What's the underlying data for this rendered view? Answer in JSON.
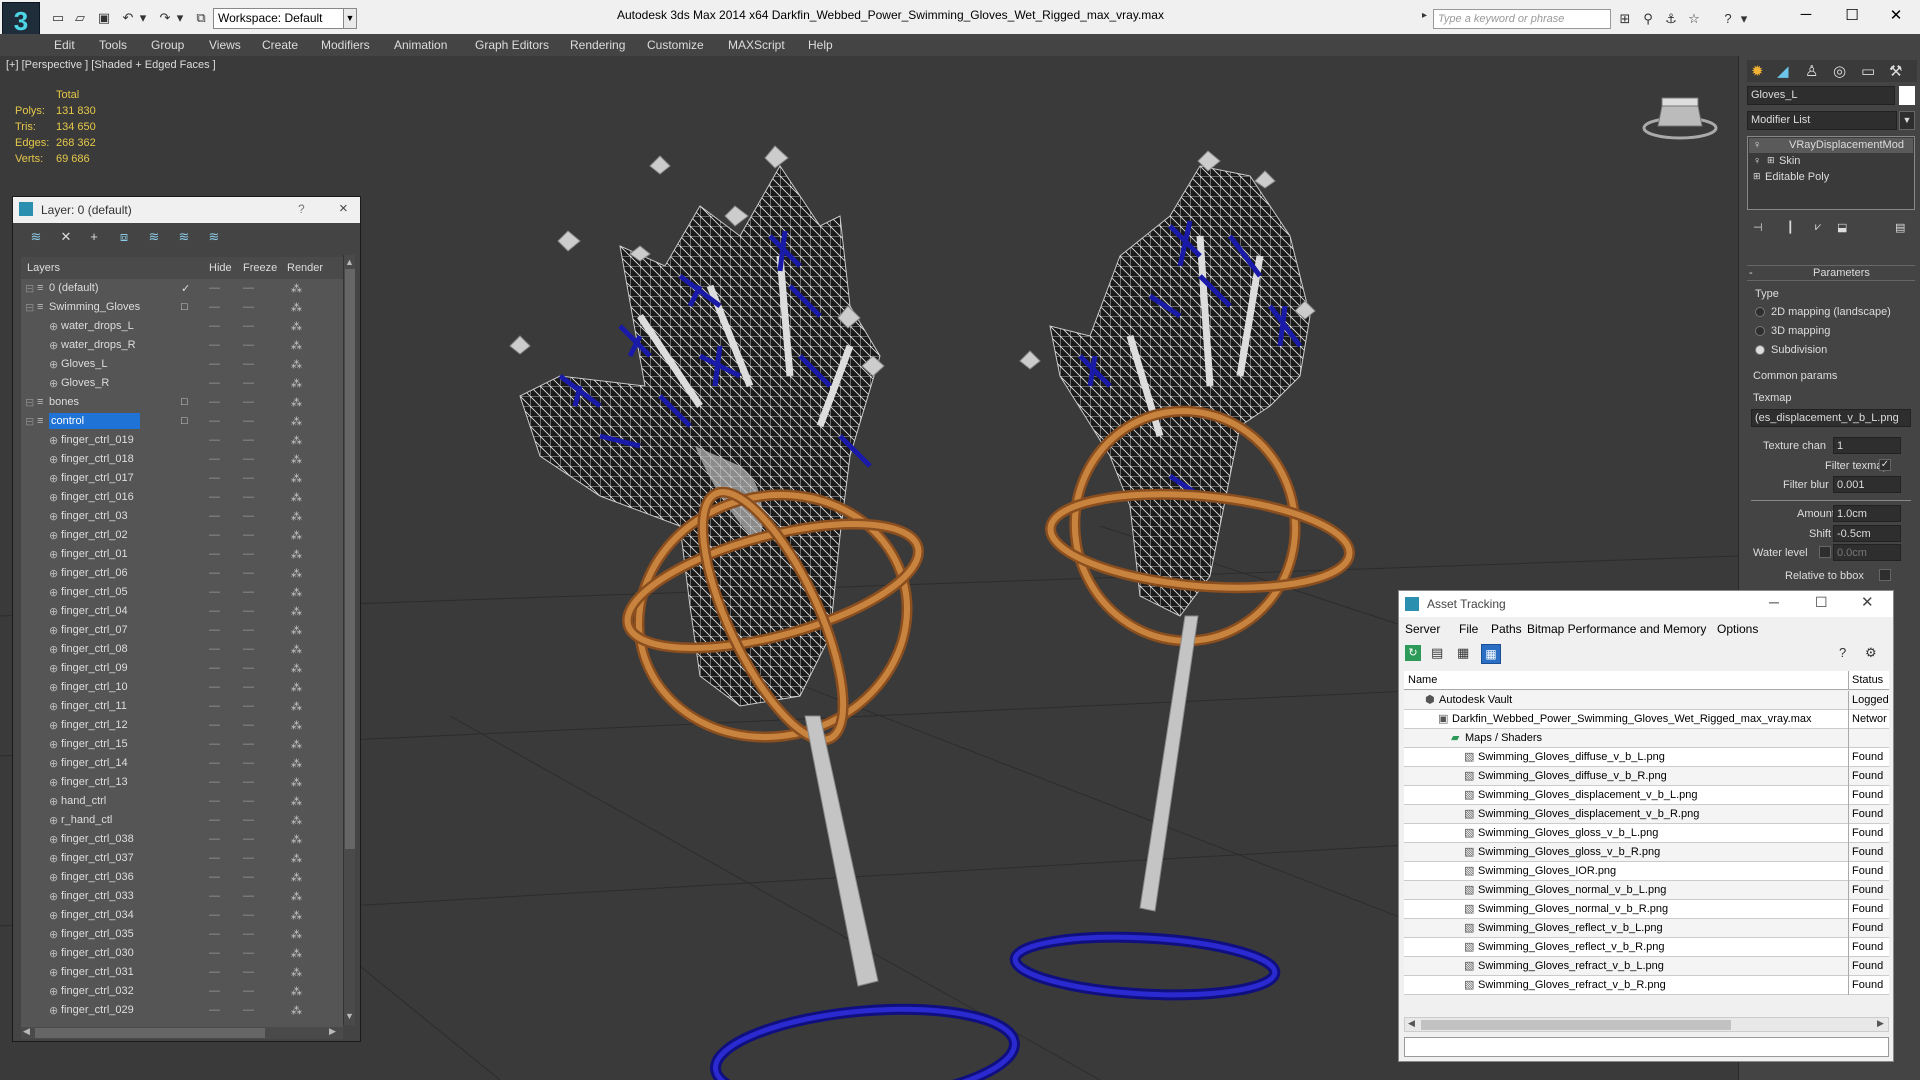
{
  "app": {
    "logo_glyph": "3",
    "title": "Autodesk 3ds Max  2014 x64      Darkfin_Webbed_Power_Swimming_Gloves_Wet_Rigged_max_vray.max",
    "workspace": "Workspace: Default",
    "search_placeholder": "Type a keyword or phrase"
  },
  "menu": [
    "Edit",
    "Tools",
    "Group",
    "Views",
    "Create",
    "Modifiers",
    "Animation",
    "Graph Editors",
    "Rendering",
    "Customize",
    "MAXScript",
    "Help"
  ],
  "viewport": {
    "label": "[+] [Perspective ] [Shaded + Edged Faces ]",
    "stats": {
      "header": "Total",
      "polys_label": "Polys:",
      "polys": "131 830",
      "tris_label": "Tris:",
      "tris": "134 650",
      "edges_label": "Edges:",
      "edges": "268 362",
      "verts_label": "Verts:",
      "verts": "69 686"
    }
  },
  "layer_panel": {
    "title": "Layer: 0 (default)",
    "help": "?",
    "close": "×",
    "columns": {
      "layers": "Layers",
      "hide": "Hide",
      "freeze": "Freeze",
      "render": "Render"
    },
    "rows": [
      {
        "name": "0 (default)",
        "level": 1,
        "check": "✓"
      },
      {
        "name": "Swimming_Gloves",
        "level": 1,
        "check": "□"
      },
      {
        "name": "water_drops_L",
        "level": 2
      },
      {
        "name": "water_drops_R",
        "level": 2
      },
      {
        "name": "Gloves_L",
        "level": 2
      },
      {
        "name": "Gloves_R",
        "level": 2
      },
      {
        "name": "bones",
        "level": 1,
        "check": "□"
      },
      {
        "name": "control",
        "level": 1,
        "check": "□",
        "selected": true
      },
      {
        "name": "finger_ctrl_019",
        "level": 2
      },
      {
        "name": "finger_ctrl_018",
        "level": 2
      },
      {
        "name": "finger_ctrl_017",
        "level": 2
      },
      {
        "name": "finger_ctrl_016",
        "level": 2
      },
      {
        "name": "finger_ctrl_03",
        "level": 2
      },
      {
        "name": "finger_ctrl_02",
        "level": 2
      },
      {
        "name": "finger_ctrl_01",
        "level": 2
      },
      {
        "name": "finger_ctrl_06",
        "level": 2
      },
      {
        "name": "finger_ctrl_05",
        "level": 2
      },
      {
        "name": "finger_ctrl_04",
        "level": 2
      },
      {
        "name": "finger_ctrl_07",
        "level": 2
      },
      {
        "name": "finger_ctrl_08",
        "level": 2
      },
      {
        "name": "finger_ctrl_09",
        "level": 2
      },
      {
        "name": "finger_ctrl_10",
        "level": 2
      },
      {
        "name": "finger_ctrl_11",
        "level": 2
      },
      {
        "name": "finger_ctrl_12",
        "level": 2
      },
      {
        "name": "finger_ctrl_15",
        "level": 2
      },
      {
        "name": "finger_ctrl_14",
        "level": 2
      },
      {
        "name": "finger_ctrl_13",
        "level": 2
      },
      {
        "name": "hand_ctrl",
        "level": 2
      },
      {
        "name": "r_hand_ctl",
        "level": 2
      },
      {
        "name": "finger_ctrl_038",
        "level": 2
      },
      {
        "name": "finger_ctrl_037",
        "level": 2
      },
      {
        "name": "finger_ctrl_036",
        "level": 2
      },
      {
        "name": "finger_ctrl_033",
        "level": 2
      },
      {
        "name": "finger_ctrl_034",
        "level": 2
      },
      {
        "name": "finger_ctrl_035",
        "level": 2
      },
      {
        "name": "finger_ctrl_030",
        "level": 2
      },
      {
        "name": "finger_ctrl_031",
        "level": 2
      },
      {
        "name": "finger_ctrl_032",
        "level": 2
      },
      {
        "name": "finger_ctrl_029",
        "level": 2
      }
    ]
  },
  "command_panel": {
    "object_name": "Gloves_L",
    "modifier_list": "Modifier List",
    "stack": [
      "VRayDisplacementMod",
      "Skin",
      "Editable Poly"
    ],
    "rollout_title": "Parameters",
    "type_label": "Type",
    "type_options": [
      "2D mapping (landscape)",
      "3D mapping",
      "Subdivision"
    ],
    "type_selected": 2,
    "common_params": "Common params",
    "texmap_label": "Texmap",
    "texmap_value": "es_displacement_v_b_L.png)",
    "texture_chan_label": "Texture chan",
    "texture_chan": "1",
    "filter_texmap_label": "Filter texmap",
    "filter_blur_label": "Filter blur",
    "filter_blur": "0.001",
    "amount_label": "Amount",
    "amount": "1.0cm",
    "shift_label": "Shift",
    "shift": "-0.5cm",
    "water_level_label": "Water level",
    "water_level": "0.0cm",
    "relative_label": "Relative to bbox"
  },
  "asset_tracking": {
    "title": "Asset Tracking",
    "menu": [
      "Server",
      "File",
      "Paths",
      "Bitmap Performance and Memory",
      "Options"
    ],
    "col_name": "Name",
    "col_status": "Status",
    "rows": [
      {
        "name": "Autodesk Vault",
        "indent": 1,
        "status": "Logged"
      },
      {
        "name": "Darkfin_Webbed_Power_Swimming_Gloves_Wet_Rigged_max_vray.max",
        "indent": 2,
        "status": "Networ"
      },
      {
        "name": "Maps / Shaders",
        "indent": 3,
        "status": ""
      },
      {
        "name": "Swimming_Gloves_diffuse_v_b_L.png",
        "indent": 4,
        "status": "Found"
      },
      {
        "name": "Swimming_Gloves_diffuse_v_b_R.png",
        "indent": 4,
        "status": "Found"
      },
      {
        "name": "Swimming_Gloves_displacement_v_b_L.png",
        "indent": 4,
        "status": "Found"
      },
      {
        "name": "Swimming_Gloves_displacement_v_b_R.png",
        "indent": 4,
        "status": "Found"
      },
      {
        "name": "Swimming_Gloves_gloss_v_b_L.png",
        "indent": 4,
        "status": "Found"
      },
      {
        "name": "Swimming_Gloves_gloss_v_b_R.png",
        "indent": 4,
        "status": "Found"
      },
      {
        "name": "Swimming_Gloves_IOR.png",
        "indent": 4,
        "status": "Found"
      },
      {
        "name": "Swimming_Gloves_normal_v_b_L.png",
        "indent": 4,
        "status": "Found"
      },
      {
        "name": "Swimming_Gloves_normal_v_b_R.png",
        "indent": 4,
        "status": "Found"
      },
      {
        "name": "Swimming_Gloves_reflect_v_b_L.png",
        "indent": 4,
        "status": "Found"
      },
      {
        "name": "Swimming_Gloves_reflect_v_b_R.png",
        "indent": 4,
        "status": "Found"
      },
      {
        "name": "Swimming_Gloves_refract_v_b_L.png",
        "indent": 4,
        "status": "Found"
      },
      {
        "name": "Swimming_Gloves_refract_v_b_R.png",
        "indent": 4,
        "status": "Found"
      }
    ]
  },
  "colors": {
    "selection": "#1f73d6",
    "stats": "#e6c84a",
    "ring_orange": "#b87332",
    "ring_blue": "#1a1aa8"
  }
}
